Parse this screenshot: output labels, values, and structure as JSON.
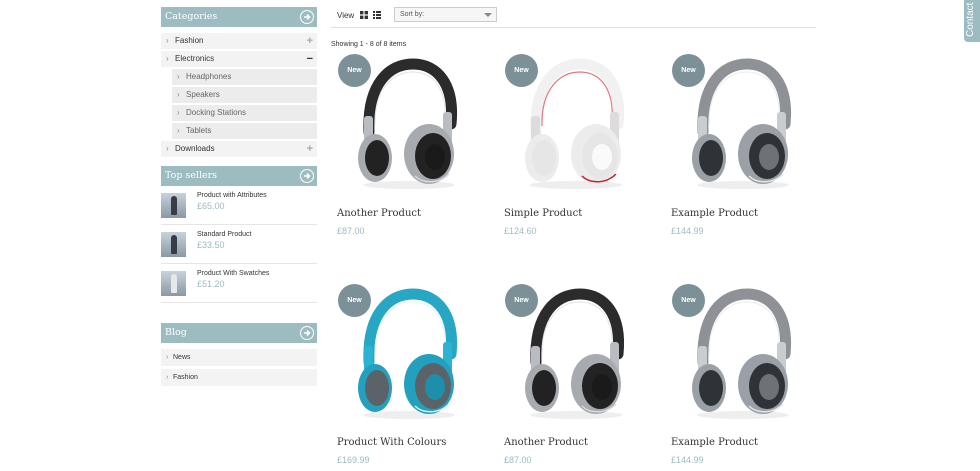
{
  "sidebar": {
    "categories_title": "Categories",
    "categories": [
      {
        "label": "Fashion",
        "toggle": "+"
      },
      {
        "label": "Electronics",
        "toggle": "−"
      },
      {
        "label": "Headphones",
        "sub": true
      },
      {
        "label": "Speakers",
        "sub": true
      },
      {
        "label": "Docking Stations",
        "sub": true
      },
      {
        "label": "Tablets",
        "sub": true
      },
      {
        "label": "Downloads",
        "toggle": "+"
      }
    ],
    "top_sellers_title": "Top sellers",
    "top_sellers": [
      {
        "name": "Product with Attributes",
        "price": "£65.00"
      },
      {
        "name": "Standard Product",
        "price": "£33.50"
      },
      {
        "name": "Product With Swatches",
        "price": "£51.20"
      }
    ],
    "blog_title": "Blog",
    "blog_items": [
      "News",
      "Fashion"
    ]
  },
  "toolbar": {
    "view_label": "View",
    "sort_placeholder": "Sort by:"
  },
  "showing": "Showing 1 - 8 of 8 items",
  "badge_label": "New",
  "products": [
    {
      "name": "Another Product",
      "price": "£87.00",
      "color": "dark"
    },
    {
      "name": "Simple Product",
      "price": "£124.60",
      "color": "white"
    },
    {
      "name": "Example Product",
      "price": "£144.99",
      "color": "chrome"
    },
    {
      "name": "Product With Colours",
      "price": "£169.99",
      "color": "blue"
    },
    {
      "name": "Another Product",
      "price": "£87.00",
      "color": "dark"
    },
    {
      "name": "Example Product",
      "price": "£144.99",
      "color": "chrome"
    }
  ],
  "contact_label": "Contact",
  "colors": {
    "accent": "#9dbcc2",
    "badge": "#7c9097"
  }
}
